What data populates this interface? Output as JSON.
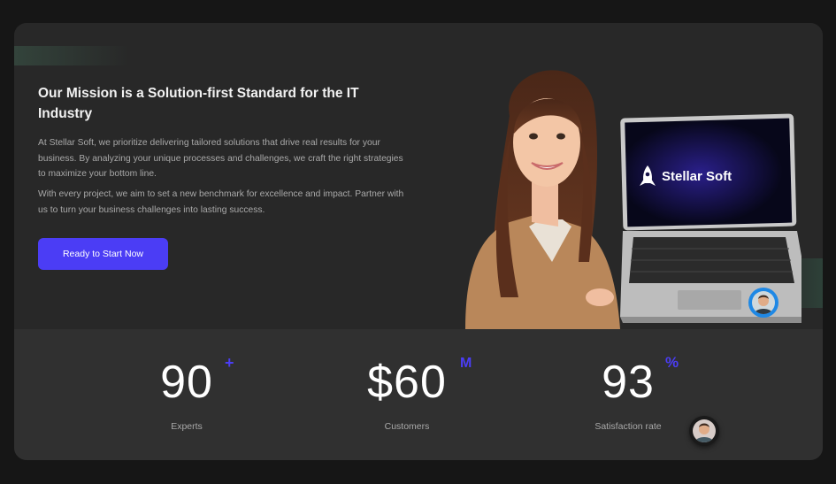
{
  "hero": {
    "heading": "Our Mission is a Solution-first Standard for the IT Industry",
    "paragraph_1": "At Stellar Soft, we prioritize delivering tailored solutions that drive real results for your business. By analyzing your unique processes and challenges, we craft the right strategies to maximize your bottom line.",
    "paragraph_2": "With every project, we aim to set a new benchmark for excellence and impact. Partner with us to turn your business challenges into lasting success.",
    "cta_label": "Ready to Start Now",
    "laptop_brand": "Stellar Soft"
  },
  "stats": [
    {
      "value": "90",
      "suffix": "+",
      "label": "Experts"
    },
    {
      "value": "$60",
      "suffix": "M",
      "label": "Customers"
    },
    {
      "value": "93",
      "suffix": "%",
      "label": "Satisfaction rate"
    }
  ],
  "colors": {
    "accent": "#4b3df5",
    "avatar_ring_blue": "#1e88e5",
    "card_bg": "#282828",
    "stats_bg": "#303030"
  },
  "icons": {
    "brand_logo": "rocket-icon",
    "chat_avatar_1": "avatar-icon",
    "chat_avatar_2": "avatar-icon"
  }
}
